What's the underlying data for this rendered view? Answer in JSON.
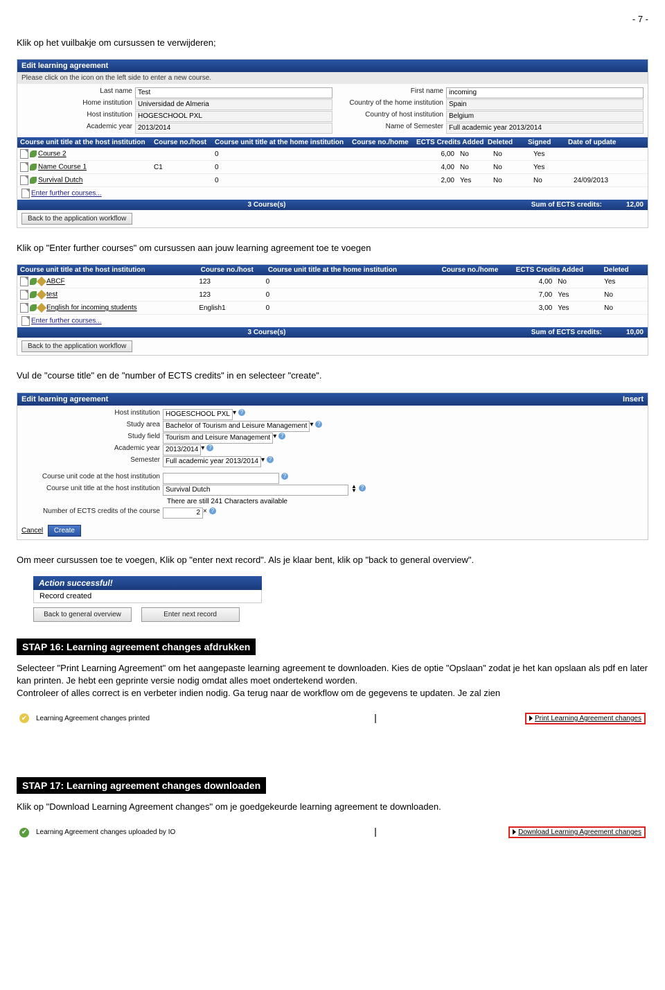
{
  "page_number": "- 7 -",
  "p1": "Klik op het vuilbakje om cursussen te verwijderen;",
  "p2": "Klik op \"Enter further courses\" om cursussen aan jouw learning agreement toe te voegen",
  "p3": "Vul  de \"course title\" en de \"number of ECTS credits\" in en selecteer \"create\".",
  "p4": "Om meer cursussen toe te voegen, Klik op \"enter next record\". Als je klaar bent, klik op \"back to general overview\".",
  "s1": {
    "header": "Edit learning agreement",
    "hint": "Please click on the icon on the left side to enter a new course.",
    "left_labels": {
      "last_name": "Last name",
      "home_inst": "Home institution",
      "host_inst": "Host institution",
      "acad_year": "Academic year"
    },
    "left_values": {
      "last_name": "Test",
      "home_inst": "Universidad de Almeria",
      "host_inst": "HOGESCHOOL PXL",
      "acad_year": "2013/2014"
    },
    "right_labels": {
      "first_name": "First name",
      "country_home": "Country of the home institution",
      "country_host": "Country of host institution",
      "semester": "Name of Semester"
    },
    "right_values": {
      "first_name": "incoming",
      "country_home": "Spain",
      "country_host": "Belgium",
      "semester": "Full academic year 2013/2014"
    },
    "cols": [
      "Course unit title at the host institution",
      "Course no./host",
      "Course unit title at the home institution",
      "Course no./home",
      "ECTS Credits Added",
      "Deleted",
      "Signed",
      "Date of update"
    ],
    "rows": [
      {
        "title": "Course 2",
        "chost": "",
        "thome": "0",
        "chome": "",
        "ects": "6,00",
        "del": "No",
        "signed": "No",
        "yes": "Yes",
        "date": ""
      },
      {
        "title": "Name Course 1",
        "chost": "C1",
        "thome": "0",
        "chome": "",
        "ects": "4,00",
        "del": "No",
        "signed": "No",
        "yes": "Yes",
        "date": ""
      },
      {
        "title": "Survival Dutch",
        "chost": "",
        "thome": "0",
        "chome": "",
        "ects": "2,00",
        "del": "Yes",
        "signed": "No",
        "yes": "No",
        "date": "24/09/2013"
      }
    ],
    "enter_link": "Enter further courses...",
    "footer_count": "3 Course(s)",
    "footer_label": "Sum of ECTS credits:",
    "footer_sum": "12,00",
    "back_btn": "Back to the application workflow"
  },
  "s2": {
    "cols": [
      "Course unit title at the host institution",
      "Course no./host",
      "Course unit title at the home institution",
      "Course no./home",
      "ECTS Credits Added",
      "Deleted"
    ],
    "rows": [
      {
        "title": "ABCF",
        "chost": "123",
        "thome": "0",
        "chome": "",
        "ects": "4,00",
        "added": "No",
        "del": "Yes"
      },
      {
        "title": "test",
        "chost": "123",
        "thome": "0",
        "chome": "",
        "ects": "7,00",
        "added": "Yes",
        "del": "No"
      },
      {
        "title": "English for incoming students",
        "chost": "English1",
        "thome": "0",
        "chome": "",
        "ects": "3,00",
        "added": "Yes",
        "del": "No"
      }
    ],
    "enter_link": "Enter further courses...",
    "footer_count": "3 Course(s)",
    "footer_label": "Sum of ECTS credits:",
    "footer_sum": "10,00",
    "back_btn": "Back to the application workflow"
  },
  "s3": {
    "header": "Edit learning agreement",
    "insert": "Insert",
    "labels": {
      "host_inst": "Host institution",
      "study_area": "Study area",
      "study_field": "Study field",
      "acad_year": "Academic year",
      "semester": "Semester",
      "code": "Course unit code at the host institution",
      "title": "Course unit title at the host institution",
      "chars": "There are still 241 Characters available",
      "ects": "Number of ECTS credits of the course"
    },
    "values": {
      "host_inst": "HOGESCHOOL PXL",
      "study_area": "Bachelor of Tourism and Leisure Management",
      "study_field": "Tourism and Leisure Management",
      "acad_year": "2013/2014",
      "semester": "Full academic year 2013/2014",
      "title": "Survival Dutch",
      "ects": "2"
    },
    "cancel": "Cancel",
    "create": "Create"
  },
  "action_success": {
    "header": "Action successful!",
    "body": "Record created",
    "back": "Back to general overview",
    "next": "Enter next record"
  },
  "step16": {
    "title": "STAP 16: Learning agreement changes afdrukken",
    "body": "Selecteer \"Print Learning Agreement\" om het aangepaste learning agreement te downloaden. Kies de optie \"Opslaan\" zodat je het kan opslaan als pdf en later kan printen. Je hebt een geprinte versie nodig omdat alles moet ondertekend worden.\nControleer of alles correct is en verbeter indien nodig. Ga terug naar de workflow om de gegevens te updaten. Je zal zien",
    "row_title": "Learning Agreement changes printed",
    "row_link": "Print Learning Agreement changes"
  },
  "step17": {
    "title": "STAP 17: Learning agreement changes downloaden",
    "body": "Klik op \"Download Learning Agreement changes\" om je goedgekeurde learning agreement te downloaden.",
    "row_title": "Learning Agreement changes uploaded by IO",
    "row_link": "Download Learning Agreement changes"
  }
}
